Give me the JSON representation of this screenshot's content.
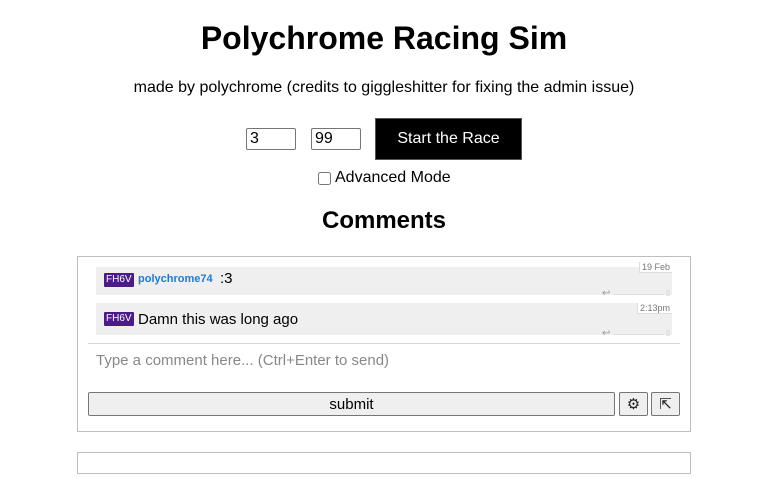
{
  "page": {
    "title": "Polychrome Racing Sim",
    "subtitle": "made by polychrome (credits to giggleshitter for fixing the admin issue)"
  },
  "controls": {
    "input1_value": "3",
    "input2_value": "99",
    "start_label": "Start the Race",
    "advanced_label": "Advanced Mode",
    "advanced_checked": false
  },
  "comments": {
    "heading": "Comments",
    "items": [
      {
        "tag": "FH6V",
        "username": "polychrome74",
        "text": ":3",
        "timestamp": "19 Feb",
        "reply_icon": "↩",
        "flag_icon": "▯"
      },
      {
        "tag": "FH6V",
        "username": "",
        "text": "Damn this was long ago",
        "timestamp": "2:13pm",
        "reply_icon": "↩",
        "flag_icon": "▯"
      }
    ],
    "input_placeholder": "Type a comment here... (Ctrl+Enter to send)",
    "submit_label": "submit",
    "gear_icon": "⚙",
    "popout_icon": "⇱"
  },
  "colors": {
    "tag_bg": "#4b1b88",
    "username": "#1e7bd4",
    "start_bg": "#000000"
  }
}
